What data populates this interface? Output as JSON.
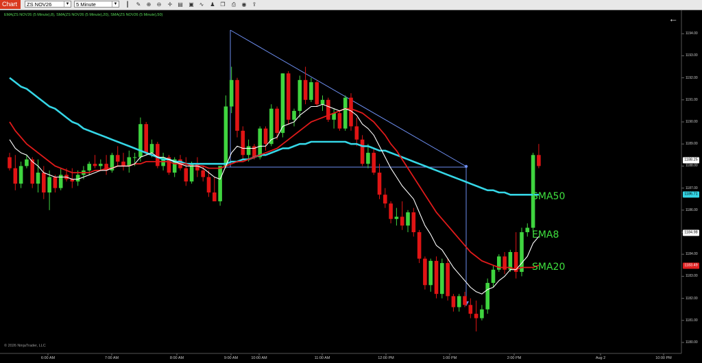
{
  "toolbar": {
    "tab_label": "Chart",
    "instrument": "ZS NOV26",
    "interval": "5 Minute",
    "icons": [
      "bar-chart-icon",
      "pencil-icon",
      "zoom-in-icon",
      "zoom-out-icon",
      "crosshair-icon",
      "properties-icon",
      "data-box-icon",
      "indicators-icon",
      "strategies-icon",
      "templates-icon",
      "print-icon",
      "snapshot-icon",
      "share-icon"
    ]
  },
  "indicator_label": "EMA(ZS NOV26 (5 Minute),8), SMA(ZS NOV26 (5 Minute),20), SMA(ZS NOV26 (5 Minute),50)",
  "copyright": "© 2026 NinjaTrader, LLC",
  "annotations": {
    "sma50": "SMA50",
    "ema8": "EMA8",
    "sma20": "SMA20"
  },
  "price_flags": [
    {
      "value": "1188.25",
      "price": 1188.25,
      "bg": "#ffffff",
      "fg": "#000000"
    },
    {
      "value": "1186.71",
      "price": 1186.71,
      "bg": "#35d6e6",
      "fg": "#000000"
    },
    {
      "value": "1184.98",
      "price": 1184.98,
      "bg": "#ffffff",
      "fg": "#000000"
    },
    {
      "value": "1183.49",
      "price": 1183.49,
      "bg": "#e02020",
      "fg": "#ffffff"
    }
  ],
  "colors": {
    "up": "#3fd43f",
    "down": "#e01414",
    "ema8": "#ffffff",
    "sma20": "#e01a1a",
    "sma50": "#35d6e6",
    "drawing": "#6d8ef0"
  },
  "chart_data": {
    "type": "candlestick",
    "ylim": [
      1180.0,
      1194.0
    ],
    "x_tick_labels": [
      "6:00 AM",
      "7:00 AM",
      "8:00 AM",
      "9:00 AM",
      "10:00 AM",
      "11:00 AM",
      "12:00 PM",
      "1:00 PM",
      "2:00 PM",
      "Aug 2",
      "10:00 PM"
    ],
    "y_tick_labels": [
      "1180.00",
      "1181.00",
      "1182.00",
      "1183.00",
      "1184.00",
      "1185.00",
      "1186.00",
      "1187.00",
      "1188.00",
      "1189.00",
      "1190.00",
      "1191.00",
      "1192.00",
      "1193.00",
      "1194.00"
    ],
    "candles": [
      [
        1188.4,
        1188.6,
        1187.8,
        1187.9
      ],
      [
        1187.9,
        1188.5,
        1186.9,
        1187.2
      ],
      [
        1187.2,
        1188.2,
        1187.0,
        1188.0
      ],
      [
        1188.0,
        1188.5,
        1187.9,
        1188.3
      ],
      [
        1188.3,
        1188.4,
        1187.0,
        1187.2
      ],
      [
        1187.2,
        1188.3,
        1186.8,
        1187.7
      ],
      [
        1187.7,
        1188.0,
        1186.5,
        1186.8
      ],
      [
        1186.8,
        1187.8,
        1186.0,
        1187.5
      ],
      [
        1187.5,
        1187.6,
        1186.8,
        1187.0
      ],
      [
        1187.0,
        1187.9,
        1186.9,
        1187.6
      ],
      [
        1187.6,
        1187.9,
        1187.3,
        1187.4
      ],
      [
        1187.4,
        1187.9,
        1187.0,
        1187.3
      ],
      [
        1187.3,
        1187.8,
        1187.1,
        1187.6
      ],
      [
        1187.6,
        1188.0,
        1187.4,
        1187.8
      ],
      [
        1187.8,
        1188.2,
        1187.6,
        1188.1
      ],
      [
        1188.1,
        1188.5,
        1187.9,
        1188.0
      ],
      [
        1188.0,
        1188.3,
        1187.8,
        1188.1
      ],
      [
        1188.1,
        1188.5,
        1187.6,
        1187.8
      ],
      [
        1187.8,
        1188.6,
        1187.7,
        1188.5
      ],
      [
        1188.5,
        1188.9,
        1188.0,
        1188.2
      ],
      [
        1188.2,
        1188.6,
        1187.8,
        1188.0
      ],
      [
        1188.0,
        1188.7,
        1187.7,
        1188.4
      ],
      [
        1188.4,
        1188.6,
        1188.0,
        1188.4
      ],
      [
        1188.4,
        1190.2,
        1188.2,
        1189.9
      ],
      [
        1189.9,
        1190.0,
        1188.5,
        1188.6
      ],
      [
        1188.6,
        1189.2,
        1188.4,
        1189.0
      ],
      [
        1189.0,
        1189.1,
        1187.9,
        1188.0
      ],
      [
        1188.0,
        1188.6,
        1187.8,
        1188.4
      ],
      [
        1188.4,
        1188.5,
        1187.6,
        1187.7
      ],
      [
        1187.7,
        1188.4,
        1187.5,
        1188.3
      ],
      [
        1188.3,
        1188.5,
        1187.8,
        1187.9
      ],
      [
        1187.9,
        1188.4,
        1187.1,
        1187.3
      ],
      [
        1187.3,
        1188.2,
        1187.2,
        1188.1
      ],
      [
        1188.1,
        1188.4,
        1187.5,
        1187.8
      ],
      [
        1187.8,
        1188.0,
        1187.3,
        1187.5
      ],
      [
        1187.5,
        1187.8,
        1186.6,
        1186.8
      ],
      [
        1186.8,
        1187.5,
        1186.4,
        1186.4
      ],
      [
        1186.4,
        1188.0,
        1186.2,
        1188.0
      ],
      [
        1188.0,
        1191.2,
        1187.9,
        1190.7
      ],
      [
        1190.7,
        1192.5,
        1190.4,
        1191.9
      ],
      [
        1191.9,
        1192.0,
        1189.3,
        1189.6
      ],
      [
        1189.6,
        1189.8,
        1188.2,
        1188.5
      ],
      [
        1188.5,
        1189.2,
        1188.2,
        1188.9
      ],
      [
        1188.9,
        1189.0,
        1188.3,
        1188.4
      ],
      [
        1188.4,
        1189.8,
        1188.3,
        1189.7
      ],
      [
        1189.7,
        1189.8,
        1188.7,
        1189.0
      ],
      [
        1189.0,
        1190.8,
        1188.9,
        1190.6
      ],
      [
        1190.6,
        1190.7,
        1189.2,
        1189.5
      ],
      [
        1189.5,
        1192.2,
        1189.3,
        1192.2
      ],
      [
        1192.2,
        1192.3,
        1189.9,
        1190.1
      ],
      [
        1190.1,
        1190.6,
        1189.8,
        1190.5
      ],
      [
        1190.5,
        1192.1,
        1190.2,
        1191.9
      ],
      [
        1191.9,
        1192.5,
        1190.8,
        1191.0
      ],
      [
        1191.0,
        1192.0,
        1190.9,
        1191.8
      ],
      [
        1191.8,
        1191.9,
        1190.7,
        1190.8
      ],
      [
        1190.8,
        1191.2,
        1190.5,
        1191.0
      ],
      [
        1191.0,
        1191.1,
        1190.0,
        1190.1
      ],
      [
        1190.1,
        1190.6,
        1189.7,
        1190.4
      ],
      [
        1190.4,
        1190.5,
        1189.6,
        1189.7
      ],
      [
        1189.7,
        1191.2,
        1189.6,
        1191.1
      ],
      [
        1191.1,
        1191.3,
        1189.6,
        1189.8
      ],
      [
        1189.8,
        1190.2,
        1188.9,
        1189.2
      ],
      [
        1189.2,
        1189.4,
        1188.0,
        1188.1
      ],
      [
        1188.1,
        1189.0,
        1187.9,
        1188.6
      ],
      [
        1188.6,
        1188.8,
        1187.6,
        1187.7
      ],
      [
        1187.7,
        1188.1,
        1186.5,
        1186.7
      ],
      [
        1186.7,
        1187.0,
        1186.1,
        1186.3
      ],
      [
        1186.3,
        1186.4,
        1185.4,
        1185.6
      ],
      [
        1185.6,
        1186.1,
        1185.3,
        1185.7
      ],
      [
        1185.7,
        1186.4,
        1185.1,
        1185.3
      ],
      [
        1185.3,
        1186.0,
        1185.0,
        1185.9
      ],
      [
        1185.9,
        1186.1,
        1184.8,
        1185.0
      ],
      [
        1185.0,
        1185.1,
        1183.6,
        1183.8
      ],
      [
        1183.8,
        1183.9,
        1182.4,
        1182.6
      ],
      [
        1182.6,
        1183.8,
        1182.3,
        1183.7
      ],
      [
        1183.7,
        1183.9,
        1182.0,
        1182.2
      ],
      [
        1182.2,
        1183.8,
        1182.0,
        1183.6
      ],
      [
        1183.6,
        1183.8,
        1181.9,
        1182.1
      ],
      [
        1182.1,
        1182.2,
        1181.4,
        1181.6
      ],
      [
        1181.6,
        1182.2,
        1181.4,
        1182.1
      ],
      [
        1182.1,
        1182.3,
        1181.6,
        1181.7
      ],
      [
        1181.7,
        1182.0,
        1181.1,
        1181.3
      ],
      [
        1181.3,
        1181.9,
        1180.5,
        1181.1
      ],
      [
        1181.1,
        1181.7,
        1181.0,
        1181.5
      ],
      [
        1181.5,
        1182.9,
        1181.3,
        1182.7
      ],
      [
        1182.7,
        1183.5,
        1182.5,
        1183.3
      ],
      [
        1183.3,
        1184.0,
        1183.2,
        1183.9
      ],
      [
        1183.9,
        1184.1,
        1183.1,
        1183.3
      ],
      [
        1183.3,
        1184.2,
        1183.2,
        1184.1
      ],
      [
        1184.1,
        1185.0,
        1182.9,
        1183.2
      ],
      [
        1183.2,
        1185.2,
        1183.0,
        1185.0
      ],
      [
        1185.0,
        1185.4,
        1184.8,
        1185.2
      ],
      [
        1185.2,
        1188.6,
        1185.0,
        1188.5
      ],
      [
        1188.5,
        1189.0,
        1187.9,
        1188.0
      ]
    ],
    "ema8": [
      1189.2,
      1188.8,
      1188.6,
      1188.5,
      1188.2,
      1188.0,
      1187.7,
      1187.6,
      1187.5,
      1187.5,
      1187.5,
      1187.4,
      1187.4,
      1187.5,
      1187.6,
      1187.7,
      1187.8,
      1187.8,
      1187.9,
      1188.0,
      1188.0,
      1188.0,
      1188.1,
      1188.4,
      1188.5,
      1188.6,
      1188.4,
      1188.4,
      1188.3,
      1188.2,
      1188.1,
      1188.0,
      1188.0,
      1188.0,
      1187.9,
      1187.7,
      1187.5,
      1187.4,
      1188.0,
      1188.6,
      1188.9,
      1188.8,
      1188.8,
      1188.8,
      1188.9,
      1188.9,
      1189.2,
      1189.3,
      1189.8,
      1189.9,
      1190.0,
      1190.3,
      1190.5,
      1190.7,
      1190.7,
      1190.8,
      1190.7,
      1190.6,
      1190.5,
      1190.6,
      1190.5,
      1190.3,
      1189.9,
      1189.7,
      1189.4,
      1188.9,
      1188.4,
      1187.9,
      1187.5,
      1187.1,
      1186.8,
      1186.5,
      1185.9,
      1185.3,
      1184.9,
      1184.4,
      1184.2,
      1183.8,
      1183.4,
      1183.1,
      1182.8,
      1182.5,
      1182.3,
      1182.2,
      1182.4,
      1182.5,
      1182.8,
      1183.0,
      1183.3,
      1183.3,
      1183.6,
      1183.9,
      1184.5,
      1184.8
    ],
    "sma20": [
      1190.0,
      1189.6,
      1189.3,
      1189.0,
      1188.8,
      1188.6,
      1188.4,
      1188.2,
      1188.0,
      1187.9,
      1187.8,
      1187.7,
      1187.7,
      1187.7,
      1187.7,
      1187.8,
      1187.8,
      1187.9,
      1187.9,
      1188.0,
      1188.0,
      1188.0,
      1188.1,
      1188.1,
      1188.2,
      1188.2,
      1188.2,
      1188.2,
      1188.2,
      1188.1,
      1188.1,
      1188.1,
      1188.0,
      1188.0,
      1188.0,
      1187.9,
      1187.9,
      1187.9,
      1188.0,
      1188.1,
      1188.2,
      1188.2,
      1188.3,
      1188.4,
      1188.5,
      1188.6,
      1188.7,
      1188.8,
      1189.0,
      1189.2,
      1189.4,
      1189.6,
      1189.8,
      1190.0,
      1190.1,
      1190.2,
      1190.3,
      1190.4,
      1190.5,
      1190.6,
      1190.6,
      1190.5,
      1190.4,
      1190.2,
      1190.0,
      1189.7,
      1189.4,
      1189.0,
      1188.7,
      1188.3,
      1187.9,
      1187.5,
      1187.1,
      1186.7,
      1186.3,
      1185.9,
      1185.6,
      1185.3,
      1185.0,
      1184.7,
      1184.4,
      1184.1,
      1183.9,
      1183.7,
      1183.6,
      1183.5,
      1183.4,
      1183.4,
      1183.4,
      1183.3,
      1183.4,
      1183.4,
      1183.4,
      1183.5
    ],
    "sma50": [
      1192.0,
      1191.8,
      1191.6,
      1191.5,
      1191.3,
      1191.1,
      1190.9,
      1190.7,
      1190.6,
      1190.4,
      1190.2,
      1190.0,
      1189.9,
      1189.7,
      1189.6,
      1189.5,
      1189.4,
      1189.3,
      1189.2,
      1189.1,
      1189.0,
      1188.9,
      1188.8,
      1188.7,
      1188.6,
      1188.5,
      1188.4,
      1188.3,
      1188.3,
      1188.2,
      1188.2,
      1188.1,
      1188.1,
      1188.1,
      1188.1,
      1188.1,
      1188.1,
      1188.1,
      1188.1,
      1188.2,
      1188.2,
      1188.3,
      1188.3,
      1188.4,
      1188.5,
      1188.5,
      1188.6,
      1188.7,
      1188.8,
      1188.8,
      1188.9,
      1189.0,
      1189.0,
      1189.1,
      1189.1,
      1189.1,
      1189.1,
      1189.1,
      1189.1,
      1189.1,
      1189.0,
      1189.0,
      1188.9,
      1188.9,
      1188.8,
      1188.7,
      1188.7,
      1188.6,
      1188.5,
      1188.4,
      1188.3,
      1188.2,
      1188.1,
      1188.0,
      1187.9,
      1187.8,
      1187.7,
      1187.6,
      1187.5,
      1187.4,
      1187.3,
      1187.2,
      1187.1,
      1187.0,
      1186.9,
      1186.9,
      1186.8,
      1186.8,
      1186.7,
      1186.7,
      1186.7,
      1186.7,
      1186.7,
      1186.7
    ]
  }
}
